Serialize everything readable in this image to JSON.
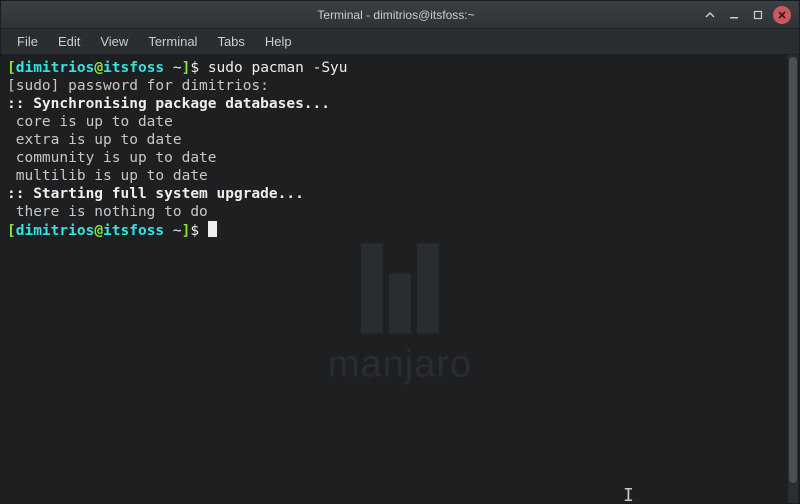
{
  "window": {
    "title": "Terminal - dimitrios@itsfoss:~"
  },
  "menubar": {
    "file": "File",
    "edit": "Edit",
    "view": "View",
    "terminal": "Terminal",
    "tabs": "Tabs",
    "help": "Help"
  },
  "prompt": {
    "user": "dimitrios",
    "at": "@",
    "host": "itsfoss",
    "path": " ~",
    "open": "[",
    "close": "]",
    "sigil": "$ "
  },
  "lines": {
    "cmd1": "sudo pacman -Syu",
    "sudo_prompt": "[sudo] password for dimitrios:",
    "sync": ":: Synchronising package databases...",
    "core": " core is up to date",
    "extra": " extra is up to date",
    "community": " community is up to date",
    "multilib": " multilib is up to date",
    "starting": ":: Starting full system upgrade...",
    "nothing": " there is nothing to do"
  },
  "watermark": {
    "text": "manjaro"
  }
}
